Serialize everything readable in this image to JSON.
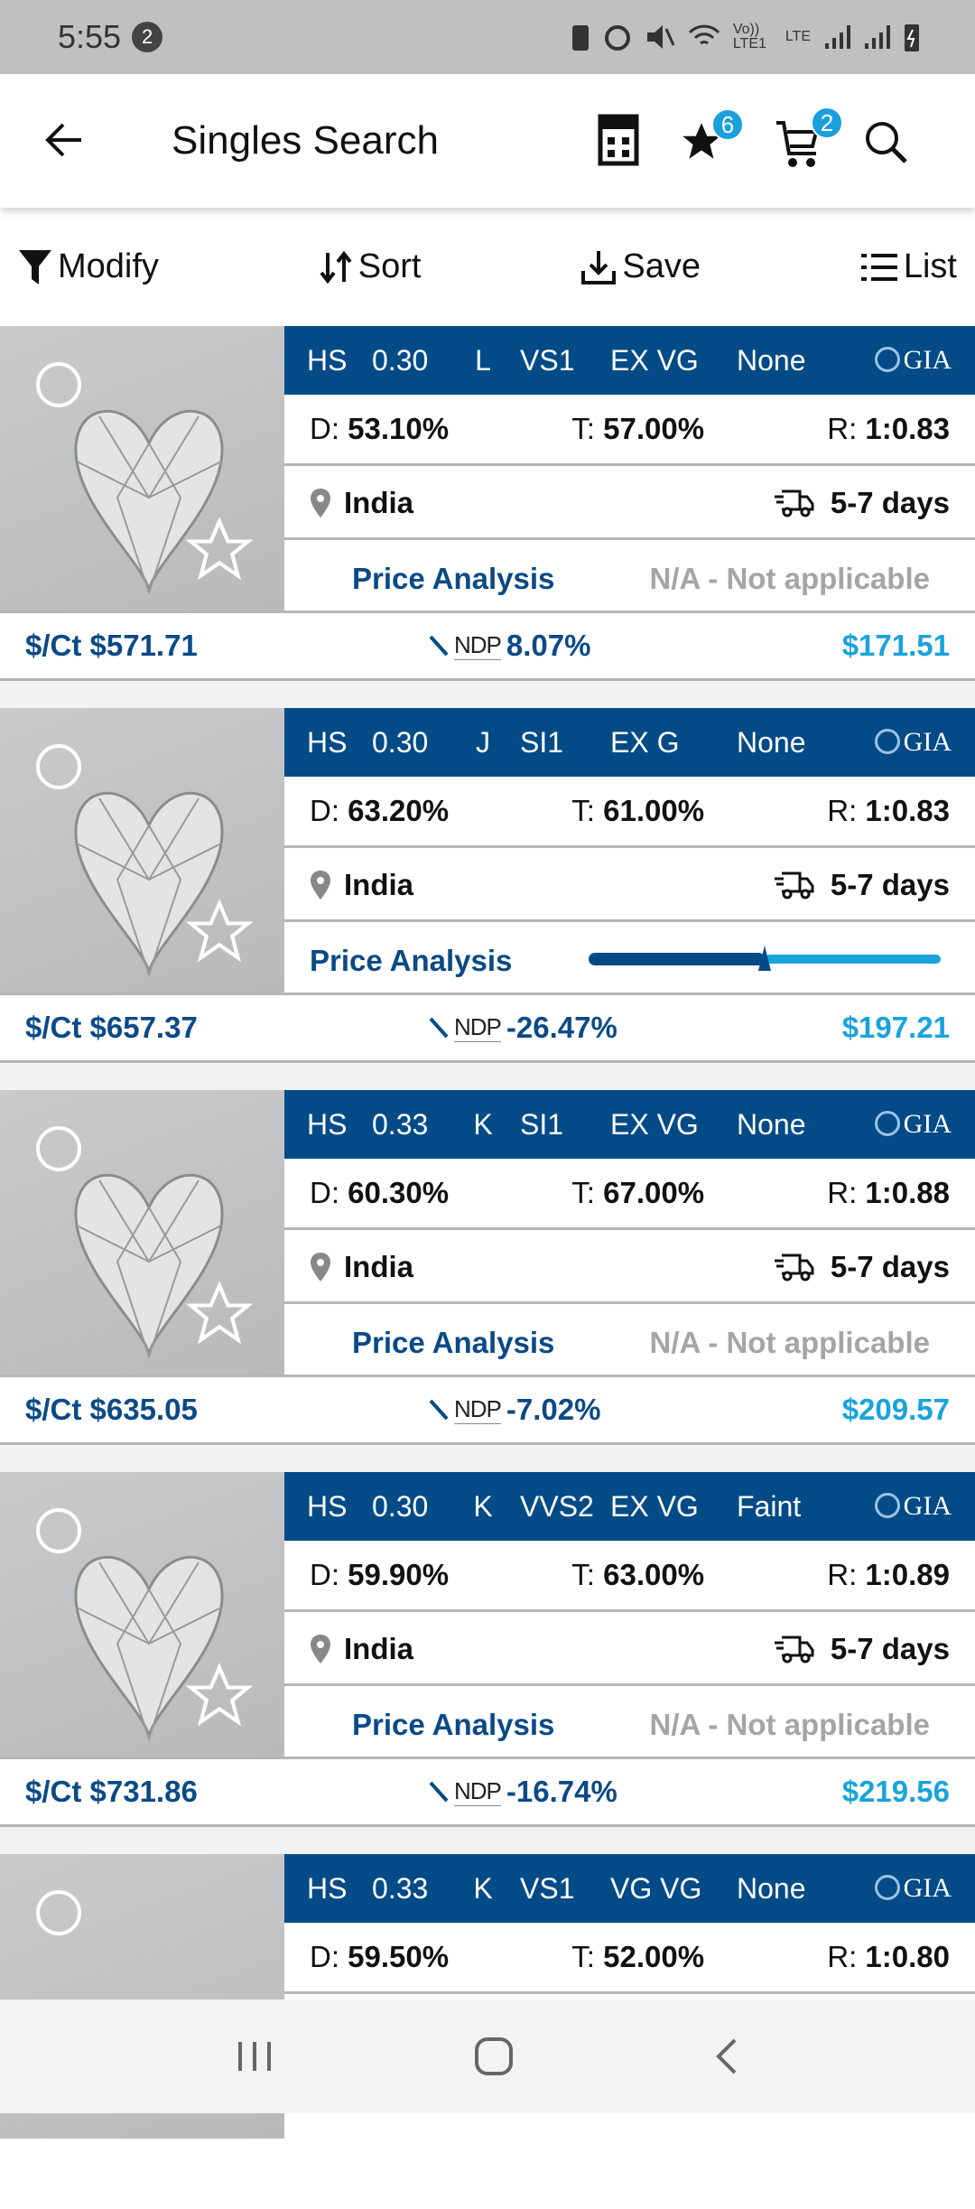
{
  "status_bar": {
    "time": "5:55",
    "notification_count": "2",
    "icons": [
      "battery-saver-icon",
      "alarm-icon",
      "mute-icon",
      "wifi-icon",
      "volte-icon",
      "lte-icon",
      "signal-icon",
      "signal-icon",
      "battery-charging-icon"
    ],
    "volte_label": "Vo)) LTE1",
    "lte_label": "LTE"
  },
  "header": {
    "title": "Singles Search",
    "favorites_count": "6",
    "cart_count": "2"
  },
  "toolbar": {
    "modify": "Modify",
    "sort": "Sort",
    "save": "Save",
    "list": "List"
  },
  "colors": {
    "primary": "#024b87",
    "accent": "#19a3db",
    "muted": "#a5a5a5"
  },
  "labels": {
    "d": "D:",
    "t": "T:",
    "r": "R:",
    "price_analysis": "Price Analysis",
    "ndp": "NDP",
    "per_ct": "$/Ct",
    "lab": "GIA"
  },
  "cards": [
    {
      "shape": "HS",
      "carat": "0.30",
      "color": "L",
      "clarity": "VS1",
      "cut": "EX VG",
      "fluor": "None",
      "depth": "53.10%",
      "table": "57.00%",
      "ratio": "1:0.83",
      "location": "India",
      "delivery": "5-7 days",
      "price_analysis": "N/A - Not applicable",
      "per_ct": "$571.71",
      "ndp": "8.07%",
      "total": "$171.51"
    },
    {
      "shape": "HS",
      "carat": "0.30",
      "color": "J",
      "clarity": "SI1",
      "cut": "EX G",
      "fluor": "None",
      "depth": "63.20%",
      "table": "61.00%",
      "ratio": "1:0.83",
      "location": "India",
      "delivery": "5-7 days",
      "price_analysis_level": 0.5,
      "per_ct": "$657.37",
      "ndp": "-26.47%",
      "total": "$197.21"
    },
    {
      "shape": "HS",
      "carat": "0.33",
      "color": "K",
      "clarity": "SI1",
      "cut": "EX VG",
      "fluor": "None",
      "depth": "60.30%",
      "table": "67.00%",
      "ratio": "1:0.88",
      "location": "India",
      "delivery": "5-7 days",
      "price_analysis": "N/A - Not applicable",
      "per_ct": "$635.05",
      "ndp": "-7.02%",
      "total": "$209.57"
    },
    {
      "shape": "HS",
      "carat": "0.30",
      "color": "K",
      "clarity": "VVS2",
      "cut": "EX VG",
      "fluor": "Faint",
      "depth": "59.90%",
      "table": "63.00%",
      "ratio": "1:0.89",
      "location": "India",
      "delivery": "5-7 days",
      "price_analysis": "N/A - Not applicable",
      "per_ct": "$731.86",
      "ndp": "-16.74%",
      "total": "$219.56"
    },
    {
      "shape": "HS",
      "carat": "0.33",
      "color": "K",
      "clarity": "VS1",
      "cut": "VG VG",
      "fluor": "None",
      "depth": "59.50%",
      "table": "52.00%",
      "ratio": "1:0.80"
    }
  ]
}
